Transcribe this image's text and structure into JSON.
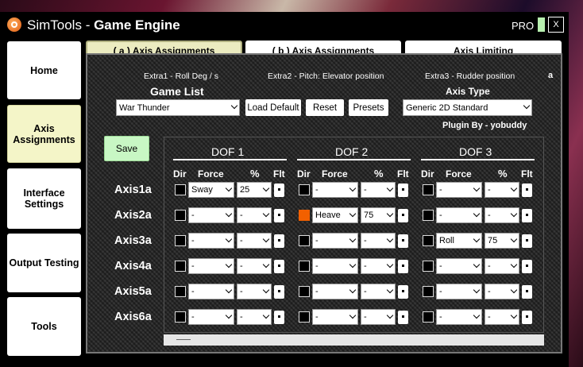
{
  "title": {
    "app": "SimTools",
    "sep": " - ",
    "engine": "Game Engine"
  },
  "pro_label": "PRO",
  "close_label": "X",
  "nav": [
    {
      "label": "Home"
    },
    {
      "label": "Axis Assignments"
    },
    {
      "label": "Interface Settings"
    },
    {
      "label": "Output Testing"
    },
    {
      "label": "Tools"
    }
  ],
  "tabs": [
    {
      "label": "( a ) Axis Assignments"
    },
    {
      "label": "( b ) Axis Assignments"
    },
    {
      "label": "Axis Limiting"
    }
  ],
  "extras": {
    "extra1": "Extra1 - Roll Deg / s",
    "extra2": "Extra2 - Pitch: Elevator position",
    "extra3": "Extra3 - Rudder position",
    "corner": "a"
  },
  "game_list": {
    "label": "Game List",
    "value": "War Thunder"
  },
  "buttons": {
    "load_default": "Load Default",
    "reset": "Reset",
    "presets": "Presets",
    "save": "Save"
  },
  "axis_type": {
    "label": "Axis Type",
    "value": "Generic 2D Standard"
  },
  "plugin_by": "Plugin By - yobuddy",
  "dof_headers": [
    "DOF 1",
    "DOF 2",
    "DOF 3"
  ],
  "col_headers": {
    "dir": "Dir",
    "force": "Force",
    "pct": "%",
    "flt": "Flt"
  },
  "axes": [
    {
      "label": "Axis1a",
      "dofs": [
        {
          "checked": false,
          "force": "Sway",
          "pct": "25"
        },
        {
          "checked": false,
          "force": "-",
          "pct": "-"
        },
        {
          "checked": false,
          "force": "-",
          "pct": "-"
        }
      ]
    },
    {
      "label": "Axis2a",
      "dofs": [
        {
          "checked": false,
          "force": "-",
          "pct": "-"
        },
        {
          "checked": true,
          "force": "Heave",
          "pct": "75"
        },
        {
          "checked": false,
          "force": "-",
          "pct": "-"
        }
      ]
    },
    {
      "label": "Axis3a",
      "dofs": [
        {
          "checked": false,
          "force": "-",
          "pct": "-"
        },
        {
          "checked": false,
          "force": "-",
          "pct": "-"
        },
        {
          "checked": false,
          "force": "Roll",
          "pct": "75"
        }
      ]
    },
    {
      "label": "Axis4a",
      "dofs": [
        {
          "checked": false,
          "force": "-",
          "pct": "-"
        },
        {
          "checked": false,
          "force": "-",
          "pct": "-"
        },
        {
          "checked": false,
          "force": "-",
          "pct": "-"
        }
      ]
    },
    {
      "label": "Axis5a",
      "dofs": [
        {
          "checked": false,
          "force": "-",
          "pct": "-"
        },
        {
          "checked": false,
          "force": "-",
          "pct": "-"
        },
        {
          "checked": false,
          "force": "-",
          "pct": "-"
        }
      ]
    },
    {
      "label": "Axis6a",
      "dofs": [
        {
          "checked": false,
          "force": "-",
          "pct": "-"
        },
        {
          "checked": false,
          "force": "-",
          "pct": "-"
        },
        {
          "checked": false,
          "force": "-",
          "pct": "-"
        }
      ]
    }
  ],
  "colors": {
    "checked": "#f26000",
    "active_nav": "#f4f5c8",
    "save": "#c8f7c4"
  }
}
